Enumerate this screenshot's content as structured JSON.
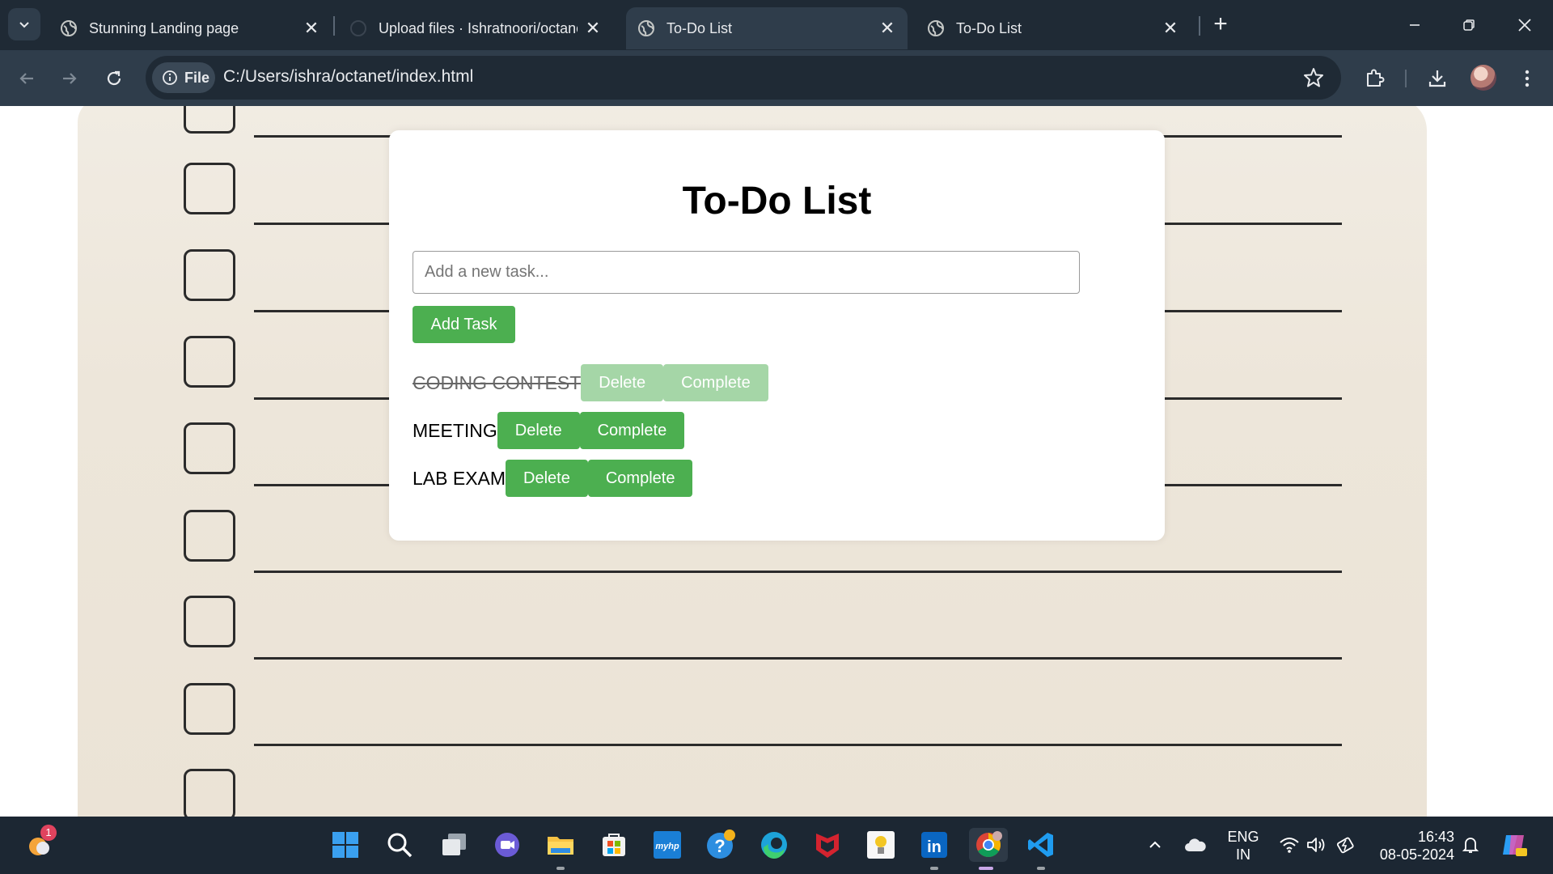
{
  "browser": {
    "tabs": [
      {
        "title": "Stunning Landing page",
        "active": false
      },
      {
        "title": "Upload files · Ishratnoori/octanet",
        "active": false
      },
      {
        "title": "To-Do List",
        "active": true
      },
      {
        "title": "To-Do List",
        "active": false
      }
    ],
    "site_chip": "File",
    "url": "C:/Users/ishra/octanet/index.html"
  },
  "app": {
    "title": "To-Do List",
    "input_placeholder": "Add a new task...",
    "add_button": "Add Task",
    "tasks": [
      {
        "label": "CODING CONTEST",
        "completed": true,
        "delete": "Delete",
        "complete": "Complete"
      },
      {
        "label": "MEETING",
        "completed": false,
        "delete": "Delete",
        "complete": "Complete"
      },
      {
        "label": "LAB EXAM",
        "completed": false,
        "delete": "Delete",
        "complete": "Complete"
      }
    ],
    "accent_color": "#4caf50"
  },
  "taskbar": {
    "notification_badge": "1",
    "language": {
      "line1": "ENG",
      "line2": "IN"
    },
    "clock": {
      "time": "16:43",
      "date": "08-05-2024"
    }
  }
}
